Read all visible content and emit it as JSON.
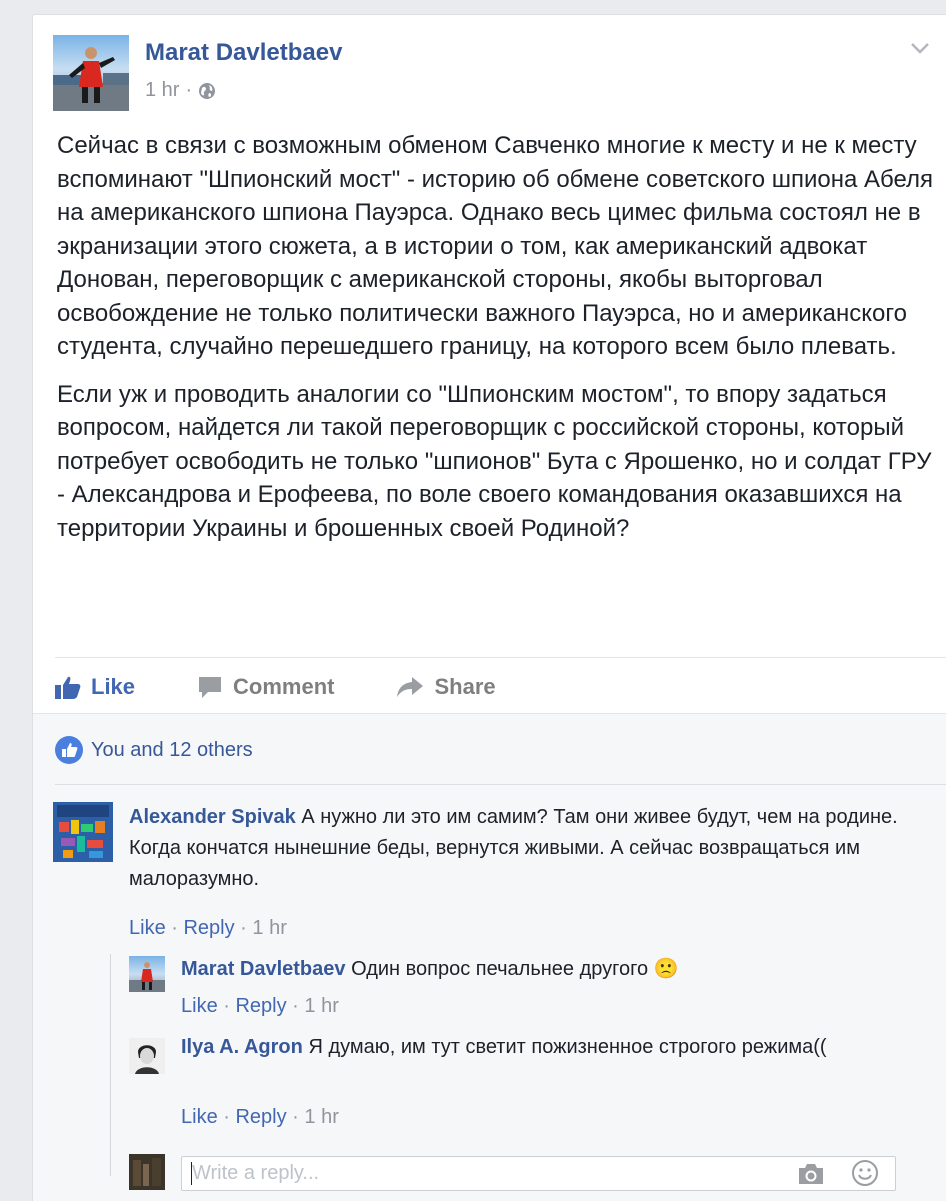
{
  "post": {
    "author": "Marat Davletbaev",
    "time": "1 hr",
    "dot": "·",
    "paragraphs": [
      "Сейчас в связи с возможным обменом Савченко многие к месту и не к месту вспоминают \"Шпионский мост\" - историю об обмене советского шпиона Абеля на американского шпиона Пауэрса. Однако весь цимес фильма состоял не в экранизации этого сюжета, а в истории о том, как американский адвокат Донован, переговорщик с американской стороны, якобы выторговал освобождение не только политически важного Пауэрса, но и американского студента, случайно перешедшего границу, на которого всем было плевать.",
      "Если уж и проводить аналогии со \"Шпионским мостом\", то впору задаться вопросом, найдется ли такой переговорщик с российской стороны, который потребует освободить не только \"шпионов\" Бута с Ярошенко, но и солдат ГРУ - Александрова и Ерофеева, по воле своего командования оказавшихся на территории Украины и брошенных своей Родиной?"
    ]
  },
  "actions": {
    "like": "Like",
    "comment": "Comment",
    "share": "Share"
  },
  "likes_summary": "You and 12 others",
  "comments": [
    {
      "name": "Alexander Spivak",
      "text": "А нужно ли это им самим? Там они живее будут, чем на родине. Когда кончатся нынешние беды, вернутся живыми. А сейчас возвращаться им малоразумно.",
      "like": "Like",
      "reply": "Reply",
      "sep": " · ",
      "time": "1 hr"
    }
  ],
  "replies": [
    {
      "name": "Marat Davletbaev",
      "text": "Один вопрос печальнее другого",
      "emoji": "🙁",
      "like": "Like",
      "reply": "Reply",
      "sep": " · ",
      "time": "1 hr"
    },
    {
      "name": "Ilya A. Agron",
      "text": "Я думаю, им тут светит пожизненное строгого режима((",
      "like": "Like",
      "reply": "Reply",
      "sep": " · ",
      "time": "1 hr"
    }
  ],
  "reply_box": {
    "placeholder": "Write a reply..."
  },
  "icons": {
    "globe": "globe-icon",
    "chevron": "chevron-down-icon",
    "thumb": "thumbs-up-icon",
    "comment": "comment-bubble-icon",
    "share": "share-arrow-icon",
    "camera": "camera-icon",
    "emoji": "emoji-icon"
  },
  "colors": {
    "link": "#365899",
    "accent": "#4267b2",
    "muted": "#90949c",
    "background": "#e9ebee"
  }
}
